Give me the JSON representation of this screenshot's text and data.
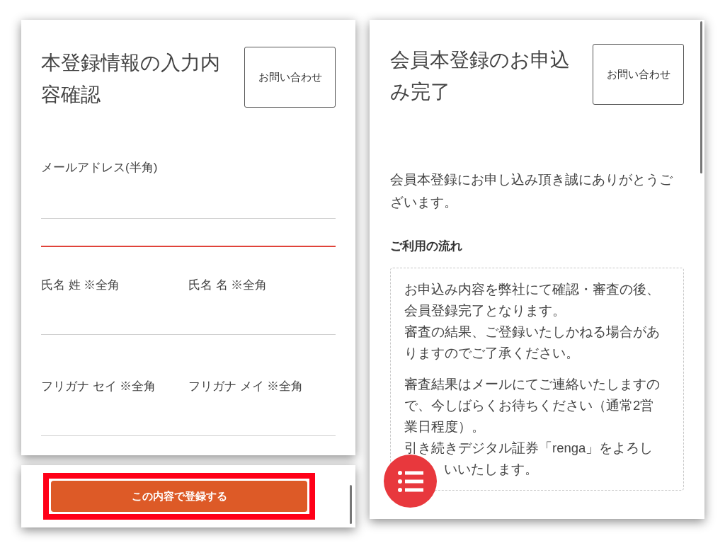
{
  "confirm_screen": {
    "title": "本登録情報の入力内容確認",
    "contact_button": "お問い合わせ",
    "fields": [
      {
        "label": "メールアドレス(半角)",
        "kind": "full"
      },
      {
        "label": "氏名 姓 ※全角",
        "kind": "half"
      },
      {
        "label": "氏名 名 ※全角",
        "kind": "half"
      },
      {
        "label": "フリガナ セイ ※全角",
        "kind": "half"
      },
      {
        "label": "フリガナ メイ ※全角",
        "kind": "half"
      }
    ],
    "submit_button": "この内容で登録する"
  },
  "complete_screen": {
    "title": "会員本登録のお申込み完了",
    "contact_button": "お問い合わせ",
    "message": "会員本登録にお申し込み頂き誠にありがとうございます。",
    "section_heading": "ご利用の流れ",
    "notice": [
      [
        {
          "text": "お申込み内容を弊社にて確認・審査の後、会員登録完了となります。",
          "kind": "line"
        },
        {
          "text": "審査の結果、ご登録いたしかねる場合がありますのでご了承ください。",
          "kind": "line"
        }
      ],
      [
        {
          "text": "審査結果はメールにてご連絡いたしますので、今しばらくお待ちください（通常2営業日程度）。",
          "kind": "line"
        },
        {
          "text": "引き続きデジタル証券「renga」をよろし",
          "kind": "line"
        },
        {
          "text": "いいたします。",
          "kind": "covered_start"
        }
      ]
    ]
  }
}
